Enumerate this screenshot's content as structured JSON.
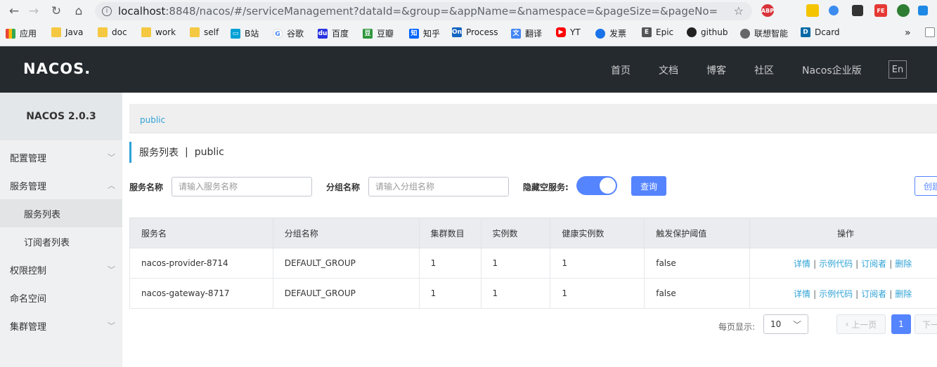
{
  "browser": {
    "url_host": "localhost",
    "url_rest": ":8848/nacos/#/serviceManagement?dataId=&group=&appName=&namespace=&pageSize=&pageNo=",
    "extensions": [
      "ABP",
      "FE"
    ],
    "bookmarks": [
      {
        "label": "应用",
        "icon": "apps-grid-icon"
      },
      {
        "label": "Java",
        "icon": "folder-icon"
      },
      {
        "label": "doc",
        "icon": "folder-icon"
      },
      {
        "label": "work",
        "icon": "folder-icon"
      },
      {
        "label": "self",
        "icon": "folder-icon"
      },
      {
        "label": "B站",
        "icon": "bilibili-icon"
      },
      {
        "label": "谷歌",
        "icon": "google-icon"
      },
      {
        "label": "百度",
        "icon": "baidu-icon"
      },
      {
        "label": "豆瓣",
        "icon": "douban-icon"
      },
      {
        "label": "知乎",
        "icon": "zhihu-icon"
      },
      {
        "label": "Process",
        "icon": "processon-icon"
      },
      {
        "label": "翻译",
        "icon": "translate-icon"
      },
      {
        "label": "YT",
        "icon": "youtube-icon"
      },
      {
        "label": "发票",
        "icon": "invoice-icon"
      },
      {
        "label": "Epic",
        "icon": "epic-icon"
      },
      {
        "label": "github",
        "icon": "github-icon"
      },
      {
        "label": "联想智能",
        "icon": "lenovo-icon"
      },
      {
        "label": "Dcard",
        "icon": "dcard-icon"
      }
    ],
    "overflow": "»"
  },
  "header": {
    "logo": "NACOS.",
    "nav": [
      "首页",
      "文档",
      "博客",
      "社区",
      "Nacos企业版"
    ],
    "lang": "En"
  },
  "sidebar": {
    "title": "NACOS 2.0.3",
    "items": [
      {
        "label": "配置管理"
      },
      {
        "label": "服务管理"
      },
      {
        "label": "服务列表"
      },
      {
        "label": "订阅者列表"
      },
      {
        "label": "权限控制"
      },
      {
        "label": "命名空间"
      },
      {
        "label": "集群管理"
      }
    ]
  },
  "main": {
    "namespace": "public",
    "page_title": "服务列表",
    "page_sep": "|",
    "page_ns": "public",
    "filters": {
      "service_label": "服务名称",
      "service_placeholder": "请输入服务名称",
      "group_label": "分组名称",
      "group_placeholder": "请输入分组名称",
      "hide_empty_label": "隐藏空服务:",
      "hide_empty_on": true,
      "query": "查询",
      "create": "创建服务"
    },
    "table": {
      "headers": [
        "服务名",
        "分组名称",
        "集群数目",
        "实例数",
        "健康实例数",
        "触发保护阈值",
        "操作"
      ],
      "rows": [
        {
          "name": "nacos-provider-8714",
          "group": "DEFAULT_GROUP",
          "clusters": "1",
          "instances": "1",
          "healthy": "1",
          "threshold": "false"
        },
        {
          "name": "nacos-gateway-8717",
          "group": "DEFAULT_GROUP",
          "clusters": "1",
          "instances": "1",
          "healthy": "1",
          "threshold": "false"
        }
      ],
      "ops": [
        "详情",
        "示例代码",
        "订阅者",
        "删除"
      ],
      "op_sep": "|"
    },
    "pager": {
      "size_label": "每页显示:",
      "page_size": "10",
      "prev": "上一页",
      "current": "1",
      "next": "下一页"
    }
  }
}
